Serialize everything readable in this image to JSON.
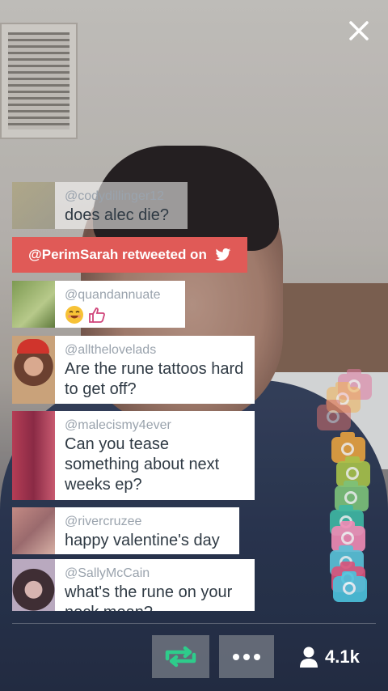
{
  "close": {
    "icon": "close-icon"
  },
  "messages": [
    {
      "username": "@codydillinger12",
      "text": "does alec die?",
      "faded": true
    },
    {
      "username": "@quandannuate",
      "emojis": [
        "smiling-face-emoji",
        "thumbs-up-emoji"
      ]
    },
    {
      "username": "@allthelovelads",
      "text": "Are the rune tattoos hard to get off?"
    },
    {
      "username": "@malecismy4ever",
      "text": "Can you tease something about next weeks ep?"
    },
    {
      "username": "@rivercruzee",
      "text": "happy valentine's day"
    },
    {
      "username": "@SallyMcCain",
      "text": "what's the rune on your neck mean?"
    }
  ],
  "retweet_banner": {
    "text": "@PerimSarah retweeted on",
    "color": "#e05a57"
  },
  "hearts": {
    "colors": [
      "#e07aa0",
      "#f2b455",
      "#d4706c",
      "#e7a23f",
      "#a8c24a",
      "#7cc27a",
      "#3fb8a4",
      "#f08bb5",
      "#59c3d8",
      "#d9527a",
      "#4cc3dd"
    ]
  },
  "bottom_bar": {
    "viewers": "4.1k",
    "retweet_icon_color": "#2ecc8b"
  },
  "colors": {
    "accent": "#e05a57",
    "username": "#9aa3ad",
    "text": "#2f3a44"
  }
}
